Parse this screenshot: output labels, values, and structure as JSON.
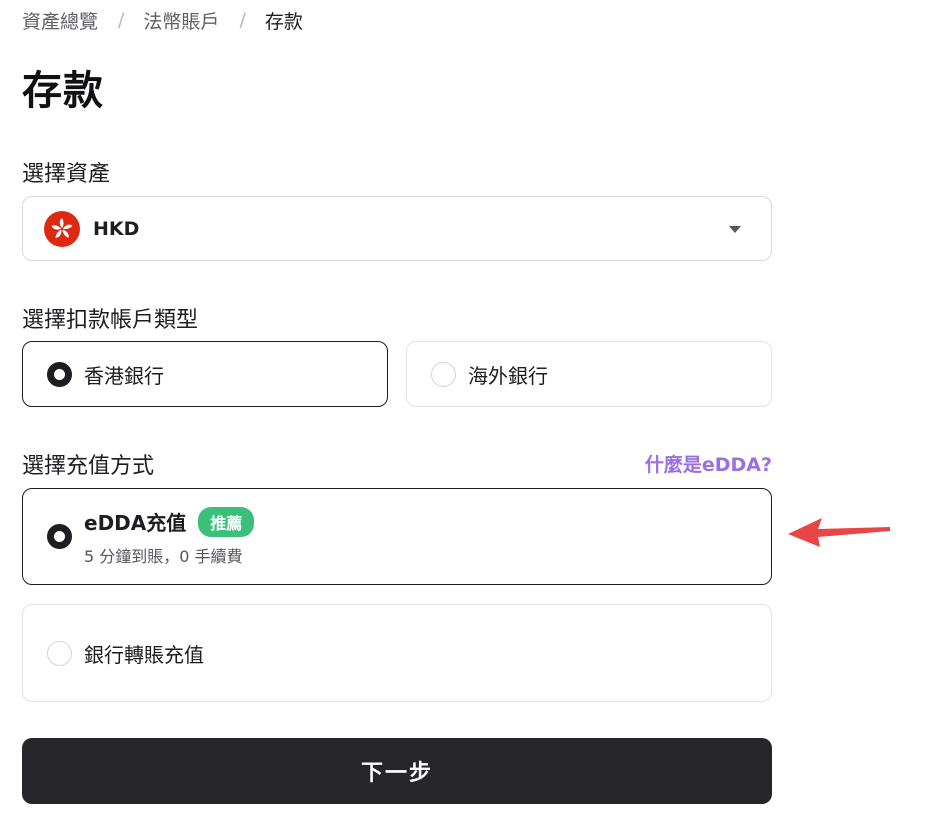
{
  "breadcrumb": {
    "items": [
      "資產總覽",
      "法幣賬戶",
      "存款"
    ],
    "separator": "/"
  },
  "page_title": "存款",
  "asset_section": {
    "label": "選擇資產",
    "selected_value": "HKD",
    "flag_icon": "hong-kong-flag-icon"
  },
  "account_type_section": {
    "label": "選擇扣款帳戶類型",
    "options": [
      {
        "label": "香港銀行",
        "selected": true
      },
      {
        "label": "海外銀行",
        "selected": false
      }
    ]
  },
  "method_section": {
    "label": "選擇充值方式",
    "help_link": "什麼是eDDA?",
    "options": [
      {
        "title": "eDDA充值",
        "badge": "推薦",
        "subtitle": "5 分鐘到賬，0 手續費",
        "selected": true
      },
      {
        "title": "銀行轉賬充值",
        "selected": false
      }
    ]
  },
  "next_button": "下一步",
  "colors": {
    "accent_link": "#9b6fe0",
    "badge_green": "#3cbf7a",
    "primary_dark": "#25252a",
    "flag_red": "#de2910",
    "annotation_arrow": "#e84646"
  }
}
